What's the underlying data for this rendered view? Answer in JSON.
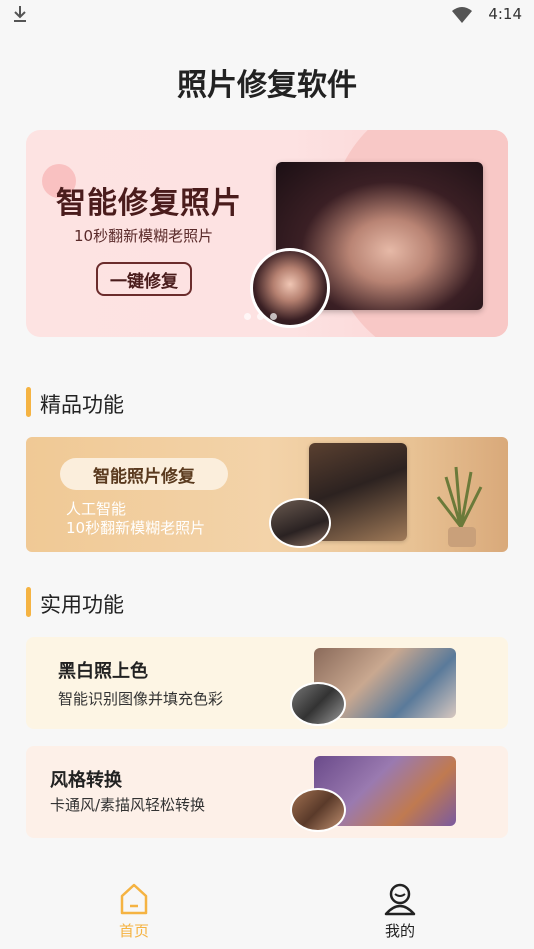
{
  "status": {
    "time": "4:14"
  },
  "app": {
    "title": "照片修复软件"
  },
  "hero": {
    "title": "智能修复照片",
    "subtitle": "10秒翻新模糊老照片",
    "button": "一键修复"
  },
  "sections": {
    "premium": "精品功能",
    "practical": "实用功能"
  },
  "premium_card": {
    "pill": "智能照片修复",
    "line1": "人工智能",
    "line2": "10秒翻新模糊老照片"
  },
  "utility_cards": [
    {
      "title": "黑白照上色",
      "subtitle": "智能识别图像并填充色彩"
    },
    {
      "title": "风格转换",
      "subtitle": "卡通风/素描风轻松转换"
    }
  ],
  "nav": [
    {
      "label": "首页",
      "icon": "home-icon",
      "active": true,
      "color": "#f5b342"
    },
    {
      "label": "我的",
      "icon": "user-icon",
      "active": false,
      "color": "#222222"
    }
  ],
  "colors": {
    "accent": "#f5b342",
    "hero_bg": "#fde3e2"
  }
}
